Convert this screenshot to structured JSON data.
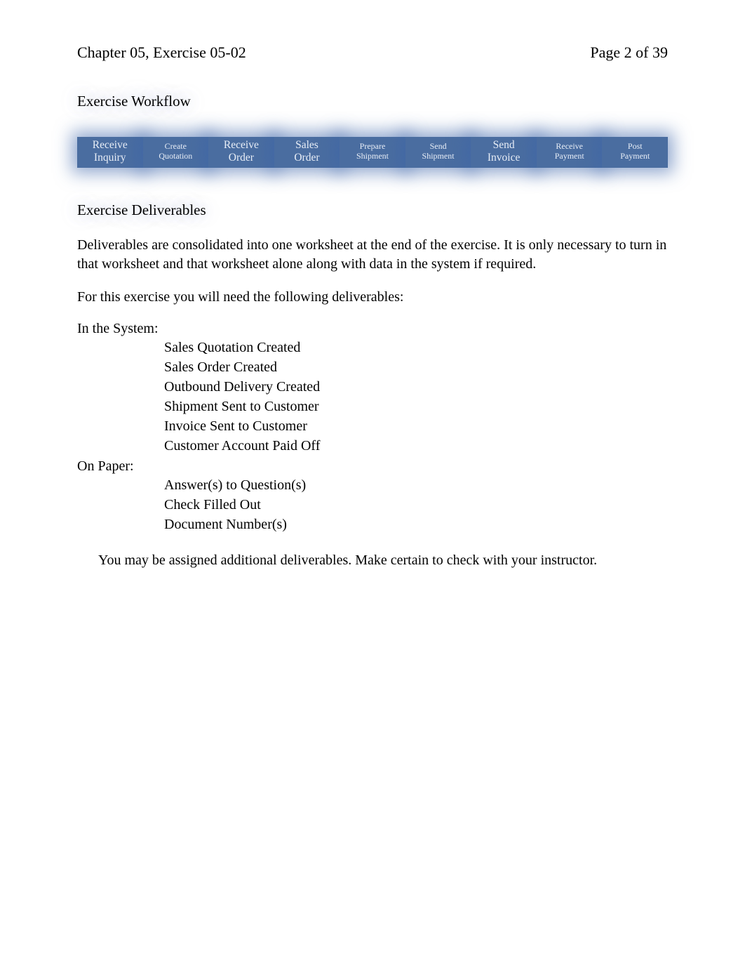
{
  "header": {
    "left": "Chapter 05, Exercise 05-02",
    "right": "Page 2 of 39"
  },
  "workflow": {
    "title": "Exercise Workflow",
    "steps": [
      {
        "line1": "Receive",
        "line2": "Inquiry",
        "size": "large"
      },
      {
        "line1": "Create",
        "line2": "Quotation",
        "size": "small"
      },
      {
        "line1": "Receive",
        "line2": "Order",
        "size": "large"
      },
      {
        "line1": "Sales",
        "line2": "Order",
        "size": "large"
      },
      {
        "line1": "Prepare",
        "line2": "Shipment",
        "size": "small"
      },
      {
        "line1": "Send",
        "line2": "Shipment",
        "size": "small"
      },
      {
        "line1": "Send",
        "line2": "Invoice",
        "size": "large"
      },
      {
        "line1": "Receive",
        "line2": "Payment",
        "size": "small"
      },
      {
        "line1": "Post",
        "line2": "Payment",
        "size": "small"
      }
    ]
  },
  "deliverables": {
    "title": "Exercise Deliverables",
    "intro": "Deliverables are consolidated into one worksheet at the end of the exercise. It is only necessary to turn in that worksheet and that worksheet alone along with data in the system if required.",
    "need": "For this exercise you will need the following deliverables:",
    "system": {
      "heading": "In the System:",
      "items": [
        "Sales Quotation Created",
        "Sales Order Created",
        "Outbound Delivery Created",
        "Shipment Sent to Customer",
        "Invoice Sent to Customer",
        "Customer Account Paid Off"
      ]
    },
    "paper": {
      "heading": "On Paper:",
      "items": [
        "Answer(s) to Question(s)",
        "Check Filled Out",
        "Document Number(s)"
      ]
    },
    "note": "You may be assigned additional deliverables. Make certain to check with your instructor."
  },
  "glyphs": {
    "bullet": "",
    "alert": ""
  }
}
